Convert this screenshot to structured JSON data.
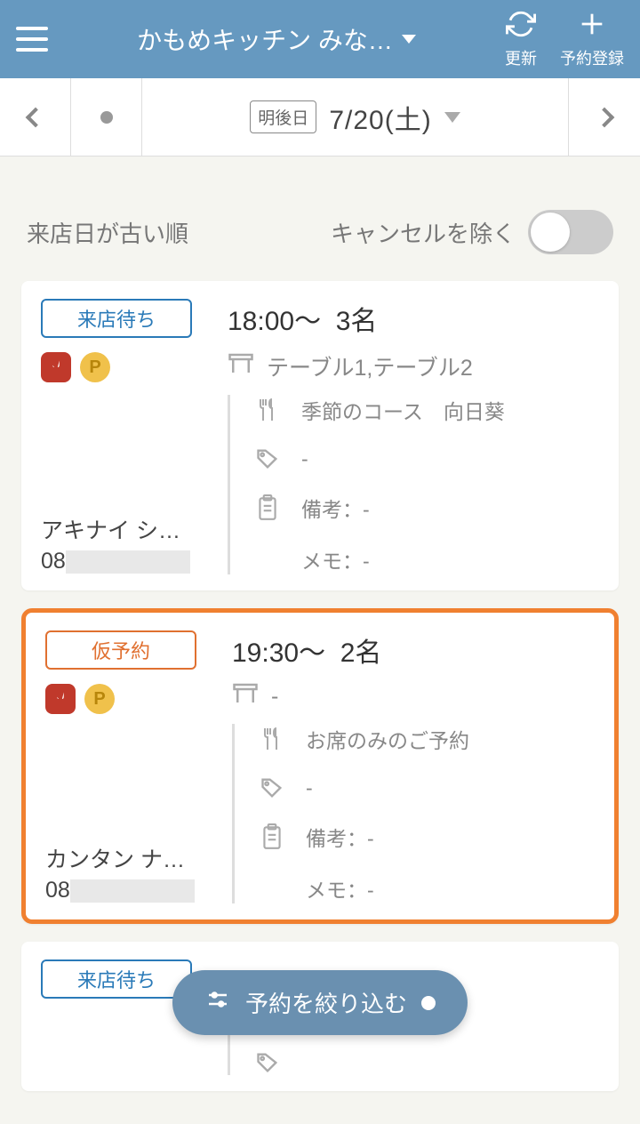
{
  "header": {
    "title": "かもめキッチン みな…",
    "refresh_label": "更新",
    "register_label": "予約登録"
  },
  "datebar": {
    "badge": "明後日",
    "date": "7/20(土)"
  },
  "filters": {
    "sort_label": "来店日が古い順",
    "cancel_label": "キャンセルを除く"
  },
  "reservations": [
    {
      "status": "来店待ち",
      "status_class": "status-waiting",
      "highlight": false,
      "time": "18:00～",
      "party": "3名",
      "tables": "テーブル1,テーブル2",
      "course": "季節のコース　向日葵",
      "tag": "-",
      "note": "備考：-",
      "memo": "メモ：-",
      "customer_name": "アキナイ シ…",
      "customer_phone_prefix": "08"
    },
    {
      "status": "仮予約",
      "status_class": "status-tentative",
      "highlight": true,
      "time": "19:30～",
      "party": "2名",
      "tables": "-",
      "course": "お席のみのご予約",
      "tag": "-",
      "note": "備考：-",
      "memo": "メモ：-",
      "customer_name": "カンタン ナ…",
      "customer_phone_prefix": "08"
    }
  ],
  "partial_status": "来店待ち",
  "fab_label": "予約を絞り込む"
}
